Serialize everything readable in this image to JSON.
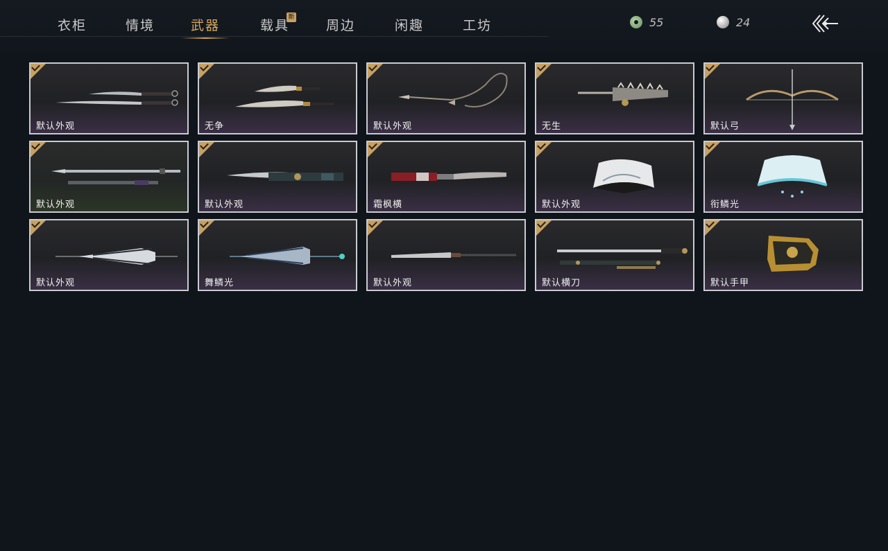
{
  "nav": {
    "tabs": [
      {
        "label": "衣柜"
      },
      {
        "label": "情境"
      },
      {
        "label": "武器"
      },
      {
        "label": "载具",
        "badge": "新"
      },
      {
        "label": "周边"
      },
      {
        "label": "闲趣"
      },
      {
        "label": "工坊"
      }
    ],
    "active_tab": "武器"
  },
  "currencies": [
    {
      "icon": "jade-coin-icon",
      "value": "55"
    },
    {
      "icon": "pearl-icon",
      "value": "24"
    }
  ],
  "items": [
    {
      "label": "默认外观",
      "art": "dual-sabers",
      "owned": true
    },
    {
      "label": "无争",
      "art": "ornate-sabers",
      "owned": true
    },
    {
      "label": "默认外观",
      "art": "rope-dart",
      "owned": true
    },
    {
      "label": "无生",
      "art": "spiked-mace",
      "owned": true
    },
    {
      "label": "默认弓",
      "art": "bow",
      "owned": true
    },
    {
      "label": "默认外观",
      "art": "long-spear",
      "owned": true
    },
    {
      "label": "默认外观",
      "art": "scabbard-sword",
      "owned": true
    },
    {
      "label": "霜枫横",
      "art": "red-scabbard-sword",
      "owned": true
    },
    {
      "label": "默认外观",
      "art": "folding-fan",
      "owned": true
    },
    {
      "label": "衔鳞光",
      "art": "jeweled-fan",
      "owned": true
    },
    {
      "label": "默认外观",
      "art": "umbrella",
      "owned": true
    },
    {
      "label": "舞鳞光",
      "art": "blue-umbrella",
      "owned": true
    },
    {
      "label": "默认外观",
      "art": "long-blade",
      "owned": true
    },
    {
      "label": "默认横刀",
      "art": "straight-sword",
      "owned": true
    },
    {
      "label": "默认手甲",
      "art": "gauntlet",
      "owned": true
    }
  ]
}
